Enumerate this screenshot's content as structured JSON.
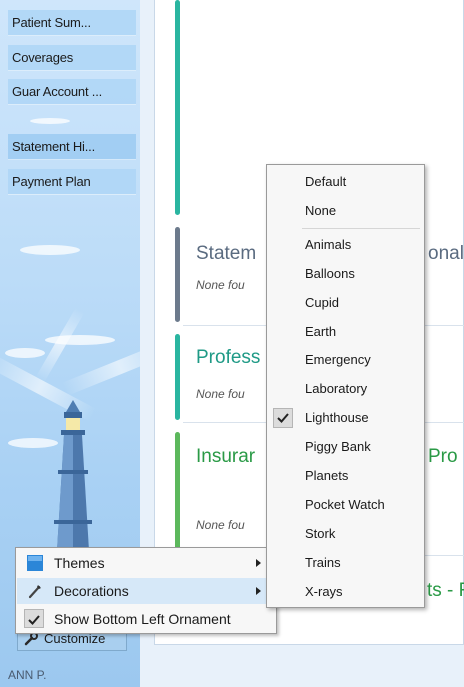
{
  "sidebar": {
    "items": [
      {
        "label": "Patient Sum..."
      },
      {
        "label": "Coverages"
      },
      {
        "label": "Guar Account ..."
      },
      {
        "label": "Statement Hi..."
      },
      {
        "label": "Payment Plan"
      }
    ]
  },
  "cards": [
    {
      "title": "Statem",
      "title_tail": "onal",
      "sub": "None fou",
      "bar_color": "#6c7a8c",
      "title_color": "#5a6b80"
    },
    {
      "title": "Profess",
      "sub": "None fou",
      "bar_color": "#2ab5a0",
      "title_color": "#1f9a86"
    },
    {
      "title": "Insurar",
      "title_tail": "Pro",
      "sub": "None fou",
      "bar_color": "#5cb85c",
      "title_color": "#2a9a46"
    },
    {
      "title_tail": "ts - F",
      "title_color": "#2a9a46"
    }
  ],
  "top_card": {
    "bar_color": "#2ab5a0"
  },
  "context_menu": {
    "themes": "Themes",
    "decorations": "Decorations",
    "show_ornament": "Show Bottom Left Ornament",
    "show_ornament_checked": true
  },
  "customize": {
    "label": "Customize"
  },
  "decorations_menu": {
    "top": [
      "Default",
      "None"
    ],
    "items": [
      "Animals",
      "Balloons",
      "Cupid",
      "Earth",
      "Emergency",
      "Laboratory",
      "Lighthouse",
      "Piggy Bank",
      "Planets",
      "Pocket Watch",
      "Stork",
      "Trains",
      "X-rays"
    ],
    "checked": "Lighthouse"
  },
  "footer": {
    "user": "ANN P."
  }
}
